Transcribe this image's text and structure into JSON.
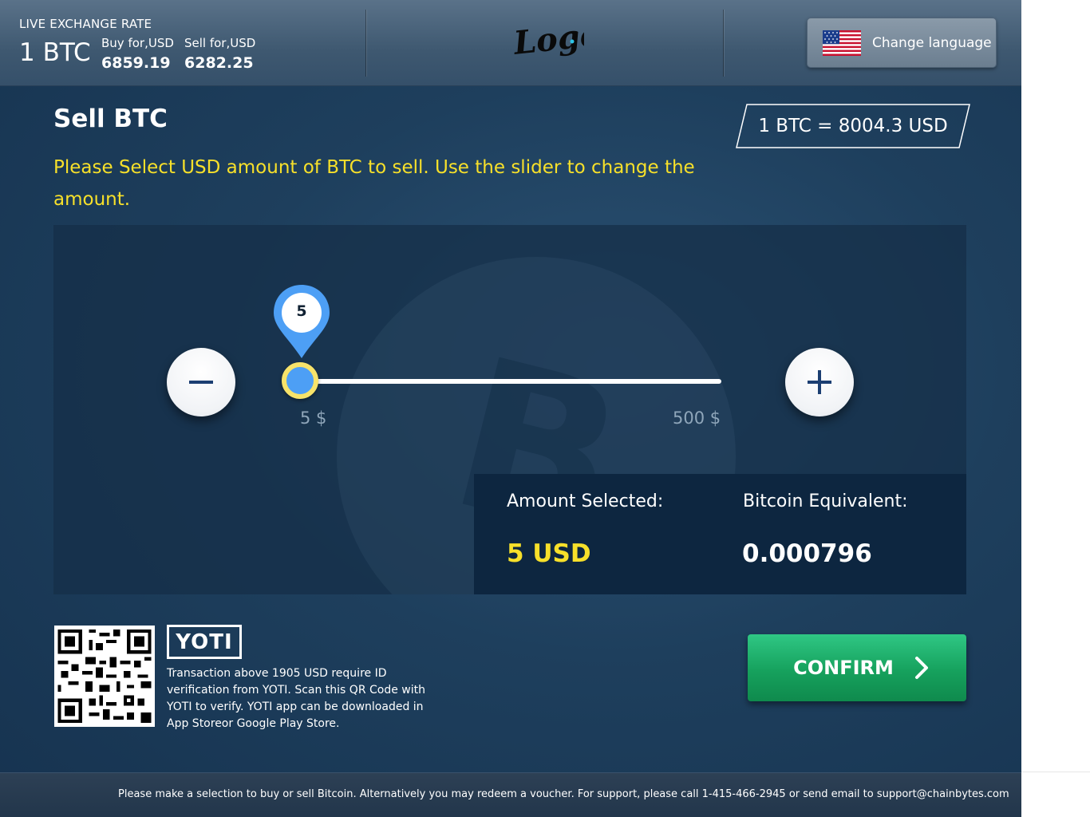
{
  "header": {
    "rate_heading": "LIVE EXCHANGE RATE",
    "unit": "1 BTC",
    "buy_label": "Buy for,USD",
    "buy_value": "6859.19",
    "sell_label": "Sell for,USD",
    "sell_value": "6282.25",
    "logo_text": "Logo",
    "language_button": "Change language",
    "language_flag_icon": "us-flag-icon"
  },
  "title": "Sell BTC",
  "instruction": "Please Select USD amount of BTC to sell. Use the slider to change the amount.",
  "rate_box": "1 BTC = 8004.3 USD",
  "slider": {
    "value": 5,
    "value_label": "5",
    "min": 5,
    "max": 500,
    "min_label": "5 $",
    "max_label": "500 $",
    "decrement_icon": "minus-icon",
    "increment_icon": "plus-icon"
  },
  "summary": {
    "amount_label": "Amount Selected:",
    "amount_value": "5 USD",
    "btc_label": "Bitcoin Equivalent:",
    "btc_value": "0.000796"
  },
  "yoti": {
    "logo_text": "YOTI",
    "description": "Transaction above 1905 USD require ID verification from YOTI. Scan this QR Code with YOTI to verify. YOTI app can be downloaded in App Storeor Google Play Store.",
    "qr_icon": "qr-code-icon"
  },
  "confirm_button": "CONFIRM",
  "footer_text": "Please make a selection to buy or sell Bitcoin. Alternatively you may redeem a voucher. For support, please call 1-415-466-2945 or send email to support@chainbytes.com",
  "colors": {
    "accent_yellow": "#f7e02a",
    "slider_handle": "#4d9ff5",
    "confirm_green": "#16a15d",
    "panel_dark": "#0d2640"
  }
}
